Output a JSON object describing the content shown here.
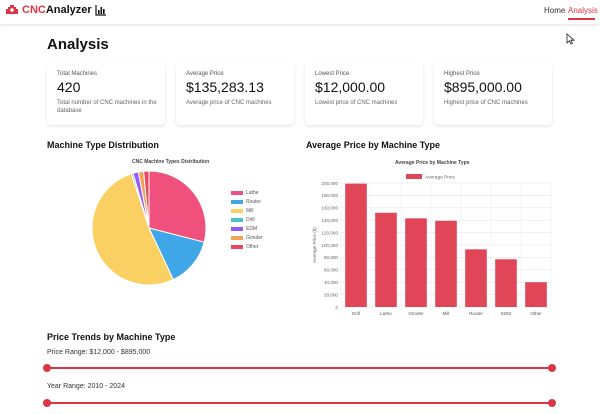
{
  "nav": {
    "brand": "CNCAnalyzer",
    "brand_prefix": "CNC",
    "brand_suffix": "Analyzer",
    "links": [
      "Home",
      "Analysis"
    ],
    "active": "Analysis",
    "accent": "#dc3545"
  },
  "page_title": "Analysis",
  "stats": [
    {
      "label": "Total Machines",
      "value": "420",
      "desc": "Total number of CNC machines in the database"
    },
    {
      "label": "Average Price",
      "value": "$135,283.13",
      "desc": "Average price of CNC machines"
    },
    {
      "label": "Lowest Price",
      "value": "$12,000.00",
      "desc": "Lowest price of CNC machines"
    },
    {
      "label": "Highest Price",
      "value": "$895,000.00",
      "desc": "Highest price of CNC machines"
    }
  ],
  "sections": {
    "type_distribution": "Machine Type Distribution",
    "avg_price": "Average Price by Machine Type",
    "price_trends": "Price Trends by Machine Type"
  },
  "filters": {
    "price_range": "Price Range: $12,000 - $895,000",
    "year_range": "Year Range: 2010 - 2024"
  },
  "chart_data": [
    {
      "type": "pie",
      "title": "CNC Machine Types Distribution",
      "categories": [
        "Lathe",
        "Router",
        "Mill",
        "Drill",
        "EDM",
        "Grinder",
        "Other"
      ],
      "values": [
        29,
        14,
        52,
        0.5,
        1.5,
        1.5,
        1.5
      ],
      "colors": [
        "#f0507c",
        "#3fa7e8",
        "#fbd063",
        "#4cc4c4",
        "#9658f5",
        "#f2a35a",
        "#e8475f"
      ],
      "legend": "right"
    },
    {
      "type": "bar",
      "title": "Average Price by Machine Type",
      "categories": [
        "Drill",
        "Lathe",
        "Grinder",
        "Mill",
        "Router",
        "EDM",
        "Other"
      ],
      "series": [
        {
          "name": "Average Price",
          "values": [
            199000,
            152000,
            143000,
            139000,
            93000,
            77000,
            40000
          ]
        }
      ],
      "ylabel": "Average Price ($)",
      "ylim": [
        0,
        200000
      ],
      "yticks": [
        "0",
        "20,000",
        "40,000",
        "60,000",
        "80,000",
        "100,000",
        "120,000",
        "140,000",
        "160,000",
        "180,000",
        "200,000"
      ],
      "color": "#e04558",
      "grid": true,
      "legend": "top"
    }
  ]
}
